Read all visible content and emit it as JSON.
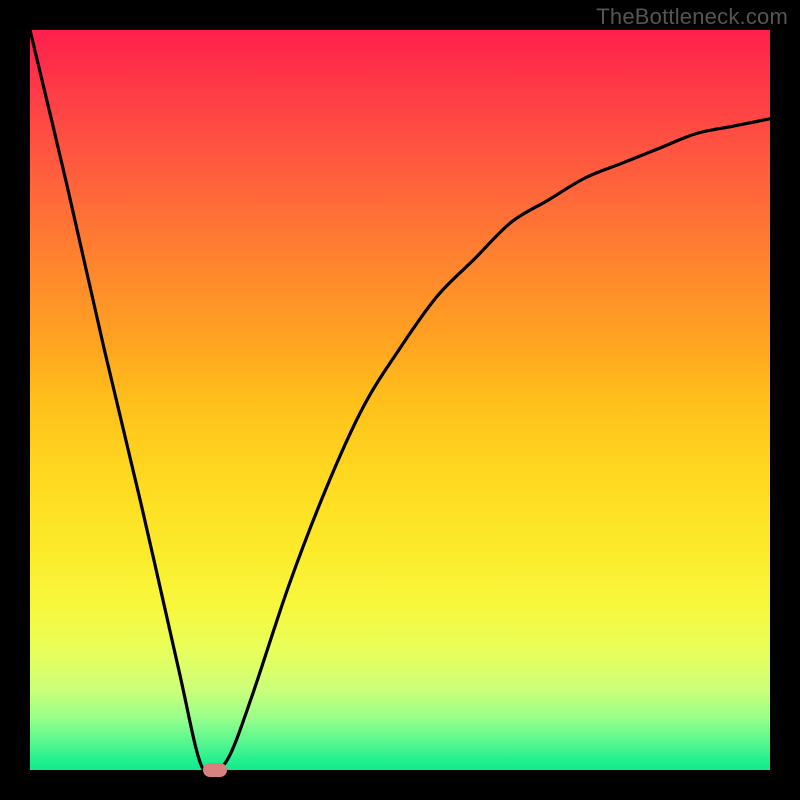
{
  "watermark": "TheBottleneck.com",
  "chart_data": {
    "type": "line",
    "title": "",
    "xlabel": "",
    "ylabel": "",
    "xlim": [
      0,
      100
    ],
    "ylim": [
      0,
      100
    ],
    "series": [
      {
        "name": "curve",
        "x": [
          0,
          5,
          10,
          15,
          20,
          23,
          25,
          27,
          30,
          35,
          40,
          45,
          50,
          55,
          60,
          65,
          70,
          75,
          80,
          85,
          90,
          95,
          100
        ],
        "y": [
          100,
          79,
          57,
          36,
          14,
          1,
          0,
          2,
          10,
          25,
          38,
          49,
          57,
          64,
          69,
          74,
          77,
          80,
          82,
          84,
          86,
          87,
          88
        ]
      }
    ],
    "marker": {
      "x": 25,
      "y": 0
    },
    "gradient_stops": [
      {
        "pos": 0.0,
        "color": "#ff1f4b"
      },
      {
        "pos": 0.5,
        "color": "#ffbf1b"
      },
      {
        "pos": 0.78,
        "color": "#f7f83e"
      },
      {
        "pos": 1.0,
        "color": "#14e98d"
      }
    ]
  }
}
